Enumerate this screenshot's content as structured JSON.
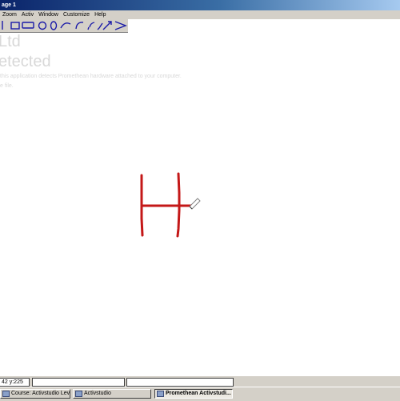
{
  "window": {
    "title": "age 1"
  },
  "menu": {
    "items": [
      "Zoom",
      "Activ",
      "Window",
      "Customize",
      "Help"
    ]
  },
  "toolbar": {
    "tools": [
      "line-tool-icon",
      "rectangle-tool-icon",
      "rounded-rectangle-tool-icon",
      "ellipse-tool-icon",
      "circle-tool-icon",
      "arc-tool-icon",
      "curve-tool-icon",
      "freehand-line-tool-icon",
      "connector-tool-icon",
      "arrow-tool-icon",
      "chevron-tool-icon"
    ],
    "color": "#1a1aa8"
  },
  "canvas": {
    "ghost_title_1": "Ltd",
    "ghost_title_2": "etected",
    "ghost_line_1": "this application detects Promethean hardware attached to your computer.",
    "ghost_line_2": "e file.",
    "ink_color": "#c41818",
    "ink_letter": "H"
  },
  "status": {
    "coords": "42  y:225",
    "panel2": "",
    "panel3": ""
  },
  "taskbar": {
    "items": [
      {
        "label": "Course: Activstudio Leve...",
        "active": false
      },
      {
        "label": "Activstudio",
        "active": false
      },
      {
        "label": "Promethean Activstudi...",
        "active": true
      }
    ]
  }
}
